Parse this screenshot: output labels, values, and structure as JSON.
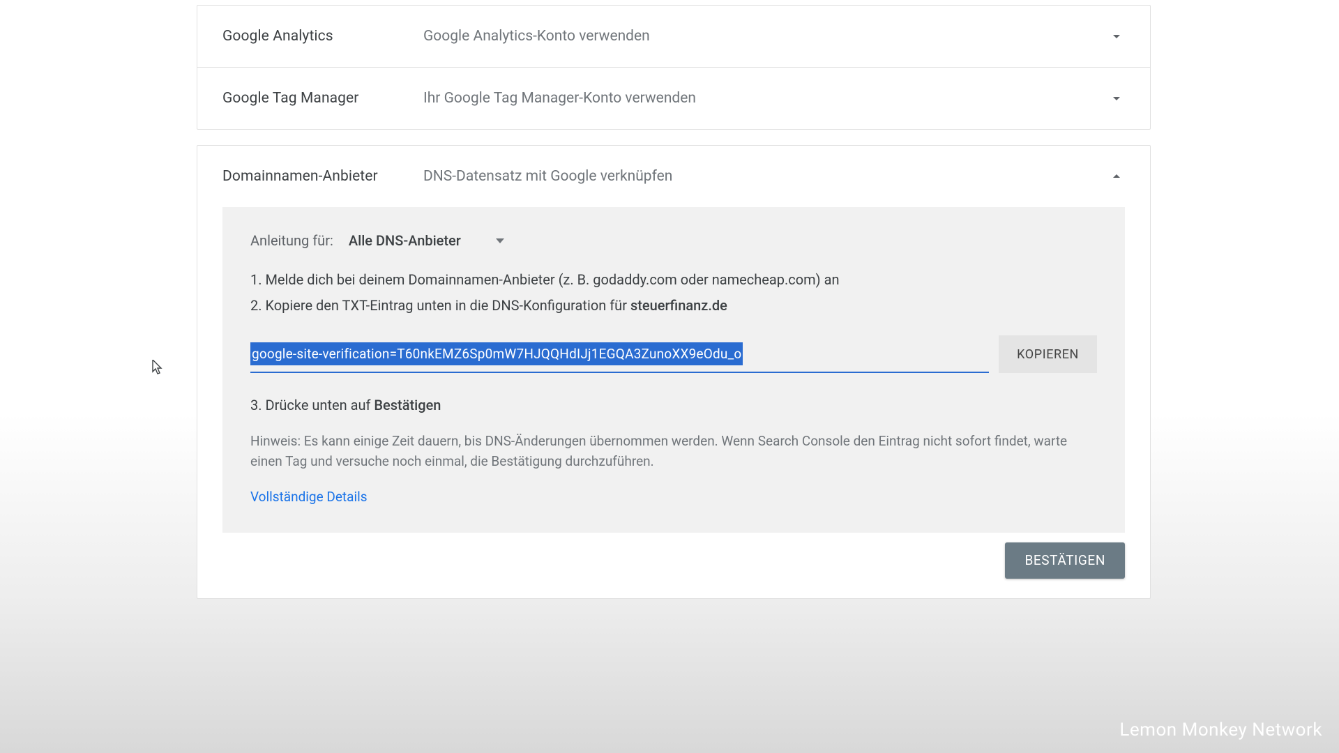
{
  "sections": {
    "analytics": {
      "title": "Google Analytics",
      "desc": "Google Analytics-Konto verwenden"
    },
    "tagmanager": {
      "title": "Google Tag Manager",
      "desc": "Ihr Google Tag Manager-Konto verwenden"
    },
    "domain": {
      "title": "Domainnamen-Anbieter",
      "desc": "DNS-Datensatz mit Google verknüpfen"
    }
  },
  "instructions": {
    "label": "Anleitung für:",
    "dropdown": "Alle DNS-Anbieter",
    "step1": "1. Melde dich bei deinem Domainnamen-Anbieter (z. B. godaddy.com oder namecheap.com) an",
    "step2_pre": "2. Kopiere den TXT-Eintrag unten in die DNS-Konfiguration für ",
    "step2_domain": "steuerfinanz.de",
    "txt_record": "google-site-verification=T60nkEMZ6Sp0mW7HJQQHdIJj1EGQA3ZunoXX9eOdu_o",
    "copy_label": "KOPIEREN",
    "step3_pre": "3. Drücke unten auf ",
    "step3_bold": "Bestätigen",
    "note": "Hinweis: Es kann einige Zeit dauern, bis DNS-Änderungen übernommen werden. Wenn Search Console den Eintrag nicht sofort findet, warte einen Tag und versuche noch einmal, die Bestätigung durchzuführen.",
    "details_link": "Vollständige Details",
    "confirm_label": "BESTÄTIGEN"
  },
  "watermark": "Lemon Monkey Network"
}
